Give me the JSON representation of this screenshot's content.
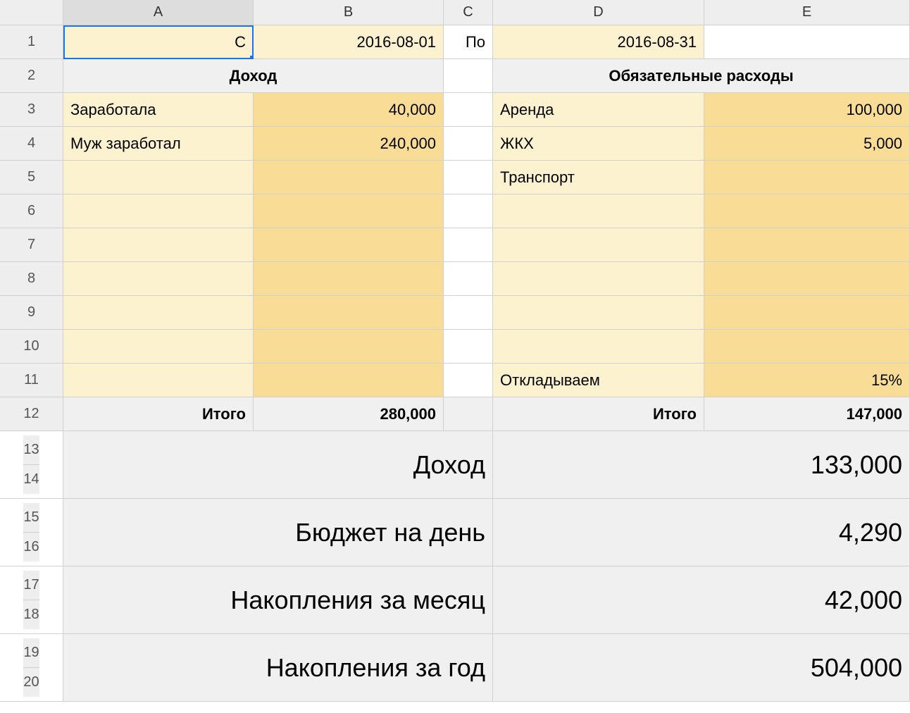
{
  "columns": [
    "A",
    "B",
    "C",
    "D",
    "E"
  ],
  "rows": [
    "1",
    "2",
    "3",
    "4",
    "5",
    "6",
    "7",
    "8",
    "9",
    "10",
    "11",
    "12",
    "13",
    "14",
    "15",
    "16",
    "17",
    "18",
    "19",
    "20"
  ],
  "dates": {
    "from_label": "С",
    "from_value": "2016-08-01",
    "to_label": "По",
    "to_value": "2016-08-31"
  },
  "income": {
    "header": "Доход",
    "rows": [
      {
        "label": "Заработала",
        "value": "40,000"
      },
      {
        "label": "Муж заработал",
        "value": "240,000"
      },
      {
        "label": "",
        "value": ""
      },
      {
        "label": "",
        "value": ""
      },
      {
        "label": "",
        "value": ""
      },
      {
        "label": "",
        "value": ""
      },
      {
        "label": "",
        "value": ""
      },
      {
        "label": "",
        "value": ""
      },
      {
        "label": "",
        "value": ""
      }
    ],
    "total_label": "Итого",
    "total_value": "280,000"
  },
  "expenses": {
    "header": "Обязательные расходы",
    "rows": [
      {
        "label": "Аренда",
        "value": "100,000"
      },
      {
        "label": "ЖКХ",
        "value": "5,000"
      },
      {
        "label": "Транспорт",
        "value": ""
      },
      {
        "label": "",
        "value": ""
      },
      {
        "label": "",
        "value": ""
      },
      {
        "label": "",
        "value": ""
      },
      {
        "label": "",
        "value": ""
      },
      {
        "label": "",
        "value": ""
      },
      {
        "label": "Откладываем",
        "value": "15%"
      }
    ],
    "total_label": "Итого",
    "total_value": "147,000"
  },
  "summary": [
    {
      "label": "Доход",
      "value": "133,000"
    },
    {
      "label": "Бюджет на день",
      "value": "4,290"
    },
    {
      "label": "Накопления за месяц",
      "value": "42,000"
    },
    {
      "label": "Накопления за год",
      "value": "504,000"
    }
  ]
}
